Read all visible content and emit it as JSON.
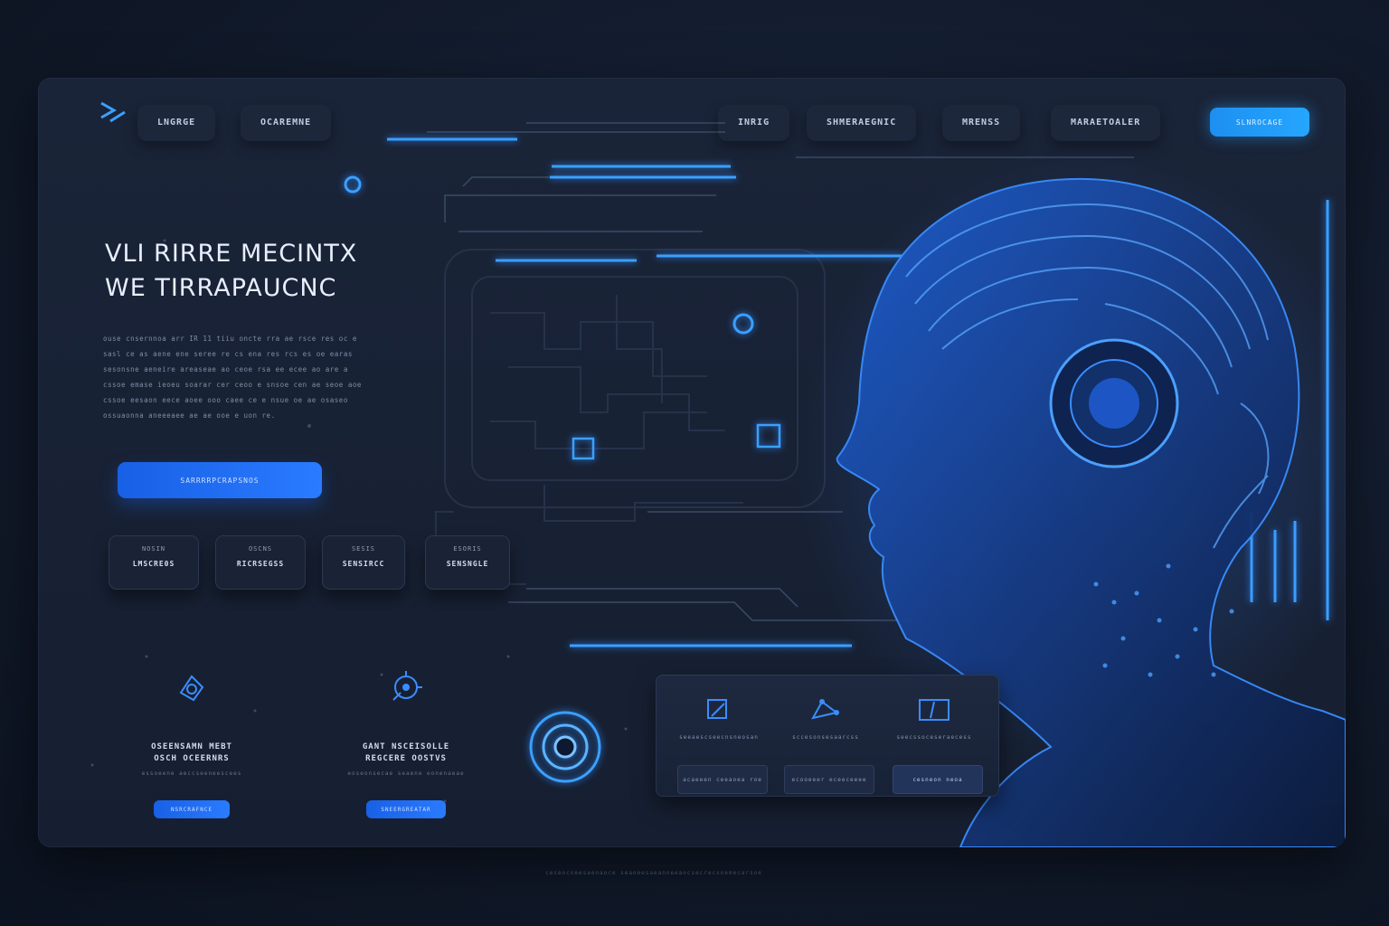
{
  "colors": {
    "background": "#121b2c",
    "frame": "#1a2438",
    "accent_blue": "#2a7bff",
    "accent_cyan": "#25a6ff",
    "text_light": "#e8eefb",
    "text_muted": "#7f8ca6"
  },
  "nav": {
    "logo_icon": "chevron-logo-icon",
    "items": [
      "LNGRGE",
      "OCAREMNE",
      "INRIG",
      "SHMERAEGNIC",
      "MRENSS",
      "MARAETOALER"
    ],
    "cta_label": "SLNROCAGE"
  },
  "hero": {
    "headline_line1": "VLI RIRRE MECINTX",
    "headline_line2": "WE TIRRAPAUCNC",
    "paragraph_lines": [
      "ouse cnsernnoa arr IR 11 tiiu oncte rra ae rsce res oc e",
      "sasl ce as aene ene seree re cs ena res rcs es oe earas",
      "sesonsne aeneire areaseae ao ceoe rsa ee ecee ao are a",
      "cssoe emase ieoeu soarar cer ceoo e snsoe cen ae seoe aoe",
      "cssoe eesaon eece aoee ooo caee ce e nsue oe ae osaseo",
      "ossuaonna aneeeaee ae ae ooe e uon re."
    ],
    "primary_cta_label": "SARRRRPCRAPSNOS"
  },
  "stat_cards": [
    {
      "top": "NOSIN",
      "bottom": "LMSCRE0S"
    },
    {
      "top": "OSCNS",
      "bottom": "RICRSEGSS"
    },
    {
      "top": "SESIS",
      "bottom": "SENSIRCC"
    },
    {
      "top": "ESORIS",
      "bottom": "SENSNGLE"
    }
  ],
  "features": [
    {
      "icon": "chip-icon",
      "line1": "OSEENSAMN MEBT",
      "line2": "OSCH OCEERNRS",
      "caption": "essoeene aeccseeneescees",
      "button": "NSRCRAFNCE"
    },
    {
      "icon": "circuit-icon",
      "line1": "GANT NSCEISOLLE",
      "line2": "REGCERE OOSTVS",
      "caption": "eoseonsecae seaene eonenaeae",
      "button": "SNEERGREATAR"
    }
  ],
  "panel": {
    "icons": [
      "send-icon",
      "network-icon",
      "window-icon"
    ],
    "captions": [
      "seeaescseecnsneosan",
      "sccesonsesaarcss",
      "seecssoceseraecess"
    ],
    "buttons": [
      "acaeeen ceeaoea roe",
      "ecooeeer eceeceeee",
      "cesneon neoa"
    ]
  },
  "footer_caption": "ceseocneesaenaoce seaoeesaeanneeaocsecrecsoemecarsoe"
}
